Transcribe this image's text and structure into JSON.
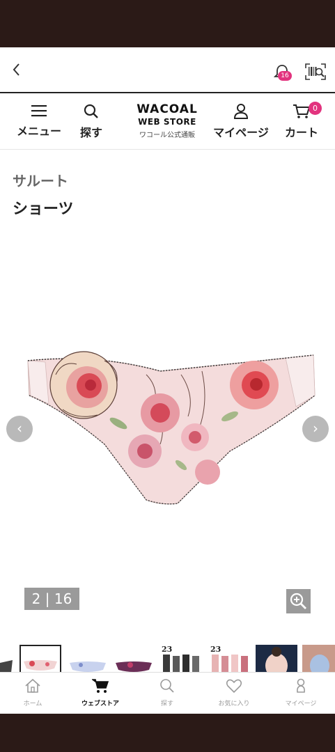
{
  "nav": {
    "notification_count": "16"
  },
  "header": {
    "menu_label": "メニュー",
    "search_label": "探す",
    "logo_line1": "WACOAL",
    "logo_line2": "WEB STORE",
    "logo_line3": "ワコール公式通販",
    "mypage_label": "マイページ",
    "cart_label": "カート",
    "cart_count": "0"
  },
  "product": {
    "brand": "サルート",
    "title": "ショーツ",
    "image_counter": "2 | 16",
    "prev_arrow": "‹",
    "next_arrow": "›"
  },
  "thumbnails": {
    "label_23a": "23",
    "label_23b": "23"
  },
  "tabbar": {
    "tabs": [
      {
        "label": "ホーム",
        "icon": "home-icon"
      },
      {
        "label": "ウェブストア",
        "icon": "cart-icon"
      },
      {
        "label": "探す",
        "icon": "search-icon"
      },
      {
        "label": "お気に入り",
        "icon": "heart-icon"
      },
      {
        "label": "マイページ",
        "icon": "person-icon"
      }
    ],
    "active_index": 1
  },
  "colors": {
    "badge": "#e2337e",
    "overlay_gray": "#9a9a9a",
    "text_dark": "#222222",
    "brand_gray": "#666666"
  }
}
